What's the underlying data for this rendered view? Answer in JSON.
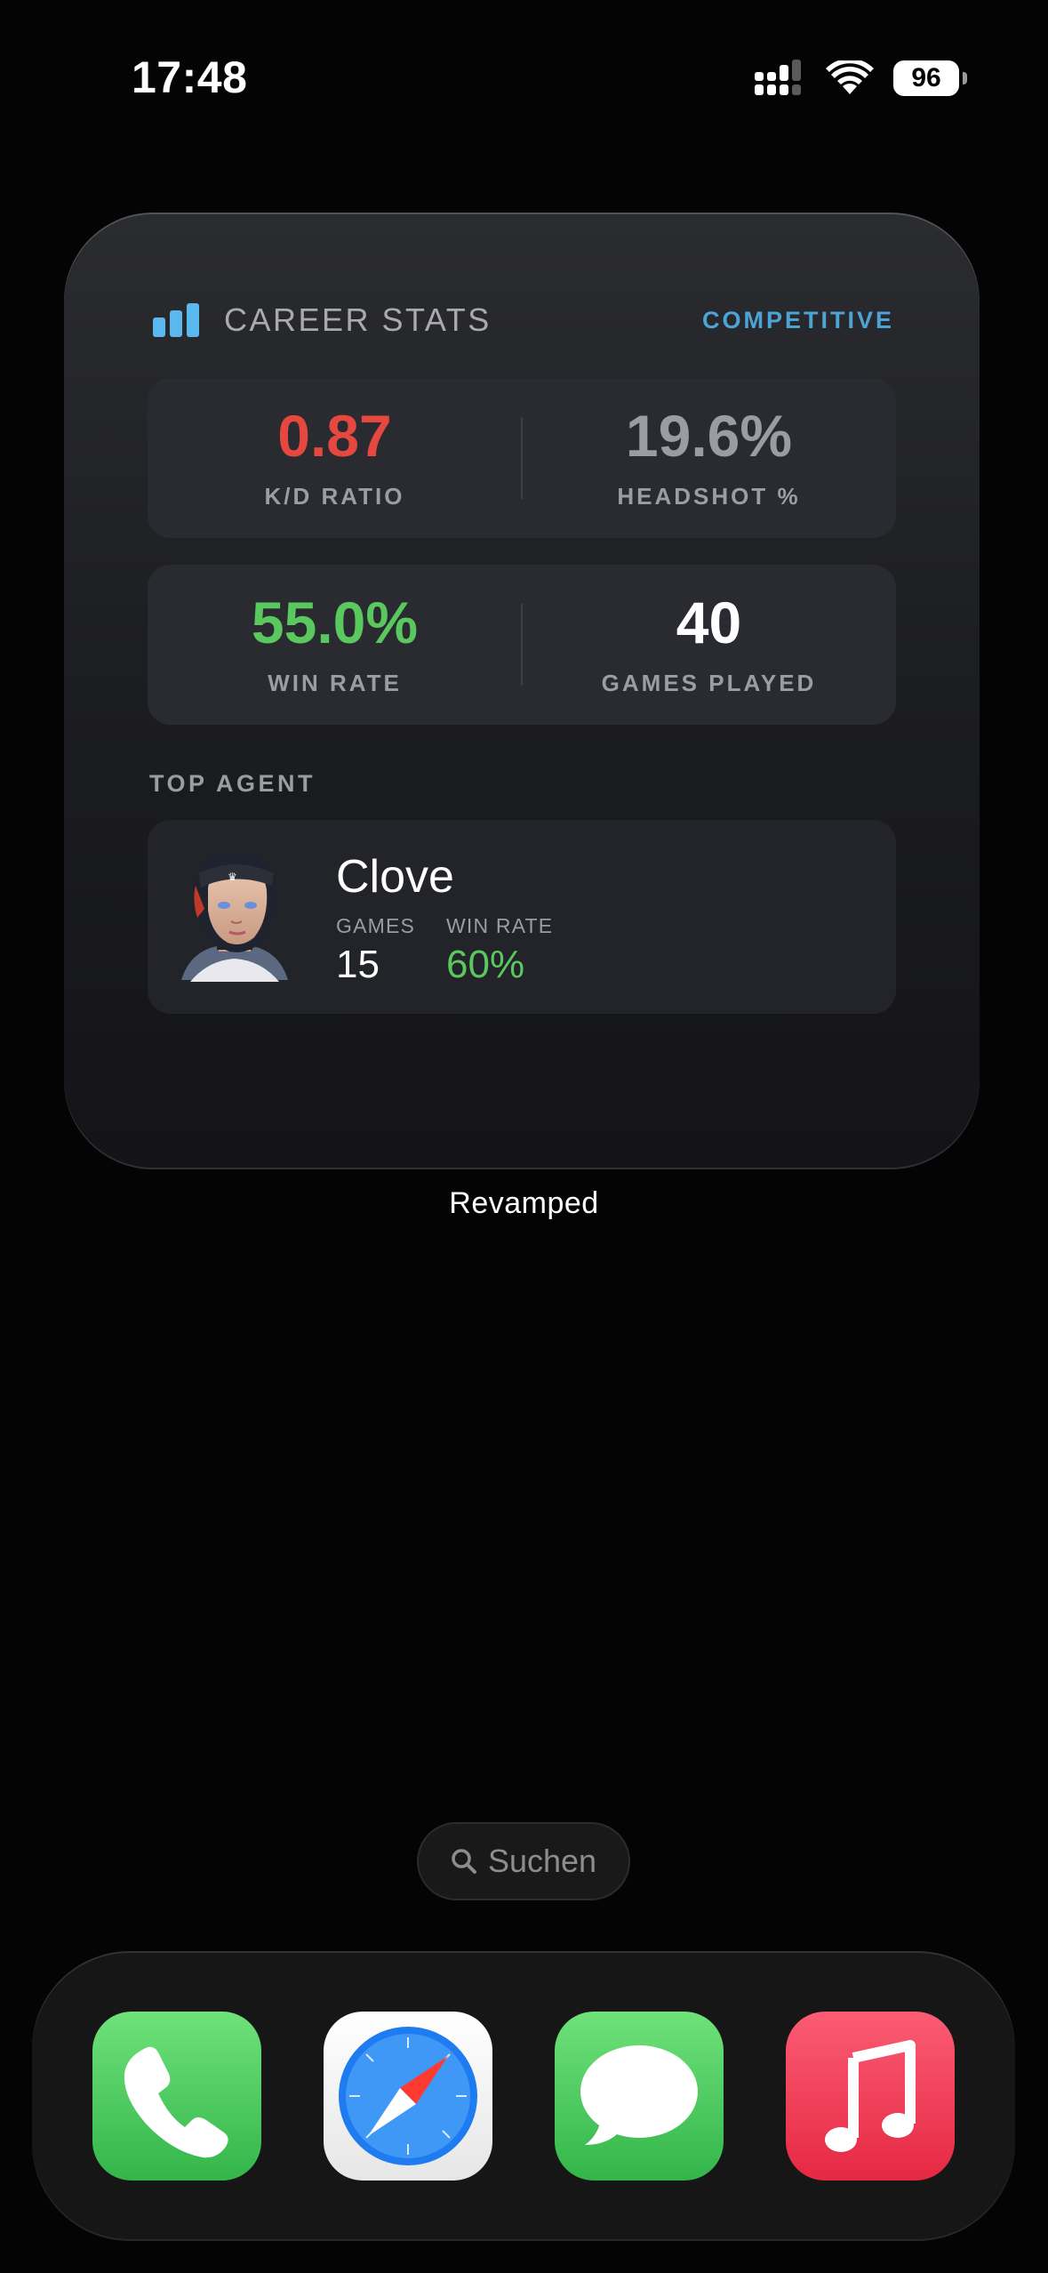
{
  "status_bar": {
    "time": "17:48",
    "battery": "96",
    "signal_icon": "cellular-signal-icon",
    "wifi_icon": "wifi-icon"
  },
  "widget": {
    "title": "CAREER STATS",
    "mode": "COMPETITIVE",
    "stats": {
      "kd": {
        "value": "0.87",
        "label": "K/D RATIO",
        "color": "#e5483f"
      },
      "headshot": {
        "value": "19.6%",
        "label": "HEADSHOT %",
        "color": "#9b9ca2"
      },
      "win_rate": {
        "value": "55.0%",
        "label": "WIN RATE",
        "color": "#5ac85f"
      },
      "games": {
        "value": "40",
        "label": "GAMES PLAYED",
        "color": "#ffffff"
      }
    },
    "top_agent": {
      "section_label": "TOP AGENT",
      "name": "Clove",
      "games_label": "GAMES",
      "games_value": "15",
      "win_rate_label": "WIN RATE",
      "win_rate_value": "60%",
      "win_rate_color": "#5ac85f"
    },
    "caption": "Revamped"
  },
  "search": {
    "label": "Suchen"
  },
  "dock": {
    "apps": [
      "Phone",
      "Safari",
      "Messages",
      "Music"
    ]
  },
  "colors": {
    "accent_blue": "#4ba3d6",
    "icon_blue": "#5ab8ee",
    "positive_green": "#5ac85f",
    "negative_red": "#e5483f"
  }
}
